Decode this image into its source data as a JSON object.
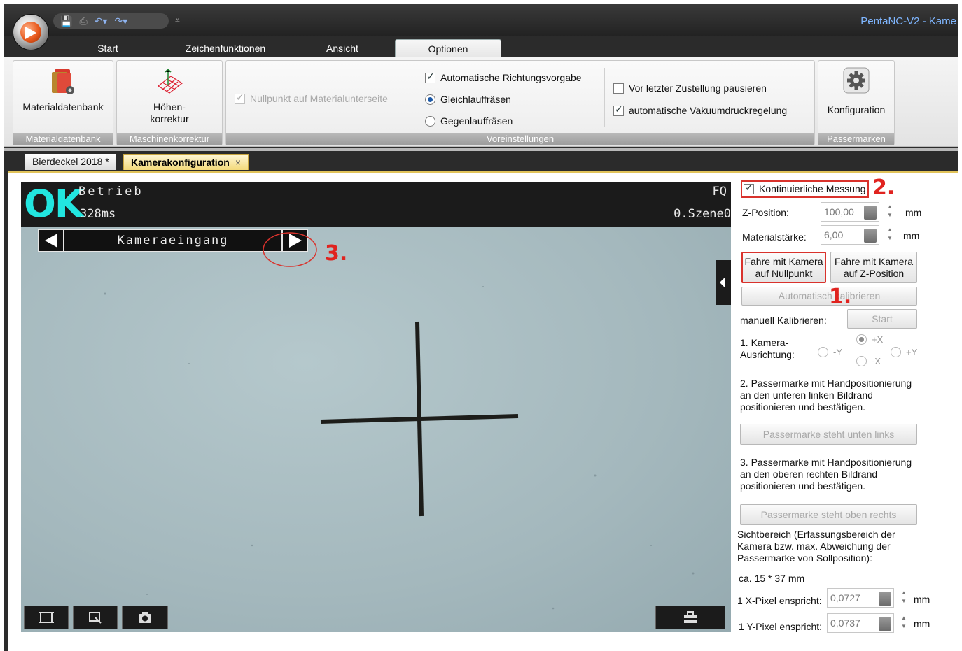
{
  "window": {
    "title": "PentaNC-V2 - Kame",
    "qat_extra": "⩡"
  },
  "ribbon_tabs": [
    {
      "label": "Start"
    },
    {
      "label": "Zeichenfunktionen"
    },
    {
      "label": "Ansicht"
    },
    {
      "label": "Optionen"
    }
  ],
  "ribbon": {
    "materialdatenbank": {
      "button": "Materialdatenbank",
      "group": "Materialdatenbank"
    },
    "maschinenkorrektur": {
      "button_line1": "Höhen-",
      "button_line2": "korrektur",
      "group": "Maschinenkorrektur"
    },
    "voreinstellungen": {
      "group": "Voreinstellungen",
      "nullpunkt": "Nullpunkt auf Materialunterseite",
      "richtungsvorgabe": "Automatische Richtungsvorgabe",
      "gleichlauf": "Gleichlauffräsen",
      "gegenlauf": "Gegenlauffräsen",
      "pausieren": "Vor letzter Zustellung pausieren",
      "vakuum": "automatische Vakuumdruckregelung"
    },
    "passermarken": {
      "button": "Konfiguration",
      "group": "Passermarken"
    }
  },
  "doc_tabs": [
    {
      "label": "Bierdeckel 2018 *"
    },
    {
      "label": "Kamerakonfiguration",
      "close": "×"
    }
  ],
  "camera": {
    "status": "OK",
    "mode": "Betrieb",
    "time": "328ms",
    "top_right_1": "FQ",
    "top_right_2": "0.Szene0",
    "input_label": "Kameraeingang"
  },
  "annotations": {
    "one": "1.",
    "two": "2.",
    "three": "3."
  },
  "panel": {
    "kontinuierlich": "Kontinuierliche Messung",
    "z_label": "Z-Position:",
    "z_value": "100,00",
    "unit": "mm",
    "mat_label": "Materialstärke:",
    "mat_value": "6,00",
    "btn_null_l1": "Fahre mit Kamera",
    "btn_null_l2": "auf Nullpunkt",
    "btn_z_l1": "Fahre mit Kamera",
    "btn_z_l2": "auf Z-Position",
    "auto_kal": "Automatisch kalibrieren",
    "manuell": "manuell Kalibrieren:",
    "start": "Start",
    "ausrichtung_l1": "1. Kamera-",
    "ausrichtung_l2": "Ausrichtung:",
    "opt_minus_y": "-Y",
    "opt_plus_x": "+X",
    "opt_minus_x": "-X",
    "opt_plus_y": "+Y",
    "step2_l1": "2. Passermarke mit Handpositionierung",
    "step2_l2": "an den unteren linken Bildrand",
    "step2_l3": "positionieren und bestätigen.",
    "btn_unten_links": "Passermarke steht unten links",
    "step3_l1": "3. Passermarke mit Handpositionierung",
    "step3_l2": "an den oberen rechten Bildrand",
    "step3_l3": "positionieren und bestätigen.",
    "btn_oben_rechts": "Passermarke steht oben rechts",
    "sicht_l1": "Sichtbereich (Erfassungsbereich der",
    "sicht_l2": "Kamera bzw. max. Abweichung der",
    "sicht_l3": "Passermarke von Sollposition):",
    "sicht_value": "ca. 15 * 37 mm",
    "xpix_label": "1 X-Pixel enspricht:",
    "xpix_value": "0,0727",
    "ypix_label": "1 Y-Pixel enspricht:",
    "ypix_value": "0,0737"
  },
  "colors": {
    "ok": "#22e6e0",
    "annotation": "#e0231f",
    "accent_tab": "#f3d97a"
  }
}
